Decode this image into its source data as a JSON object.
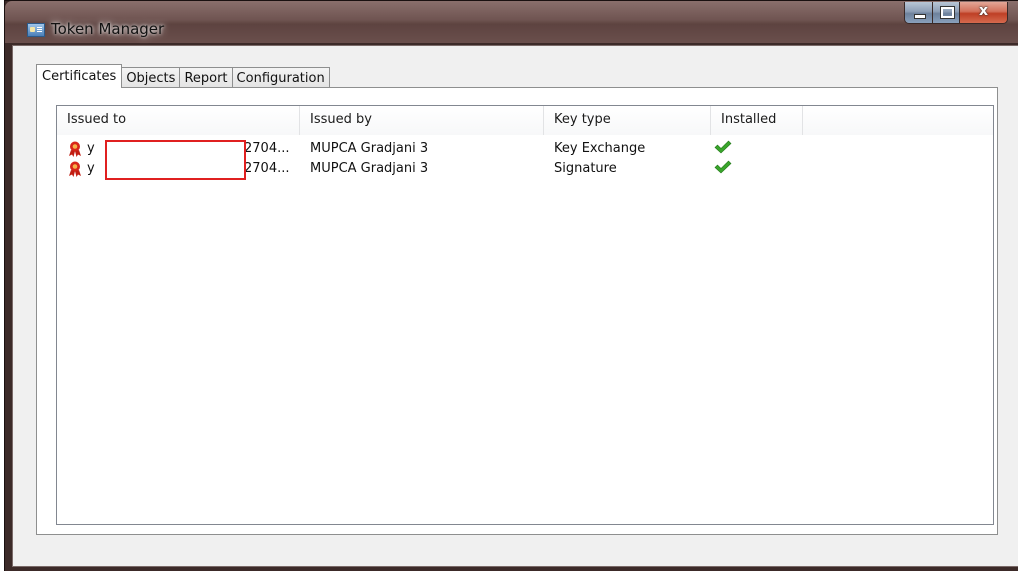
{
  "window": {
    "title": "Token Manager",
    "close_glyph": "x"
  },
  "tabs": [
    {
      "label": "Certificates",
      "active": true
    },
    {
      "label": "Objects",
      "active": false
    },
    {
      "label": "Report",
      "active": false
    },
    {
      "label": "Configuration",
      "active": false
    }
  ],
  "table": {
    "columns": [
      "Issued to",
      "Issued by",
      "Key type",
      "Installed"
    ],
    "rows": [
      {
        "issued_to": "y",
        "issued_to_tail": "2704...",
        "issued_by": "MUPCA Gradjani 3",
        "key_type": "Key Exchange",
        "installed": true,
        "icon": "certificate-icon"
      },
      {
        "issued_to": "y",
        "issued_to_tail": "2704...",
        "issued_by": "MUPCA Gradjani 3",
        "key_type": "Signature",
        "installed": true,
        "icon": "certificate-icon"
      }
    ]
  },
  "colors": {
    "redaction_border": "#e02020",
    "check_green": "#3aa52c",
    "cert_icon_red": "#d8261b"
  }
}
